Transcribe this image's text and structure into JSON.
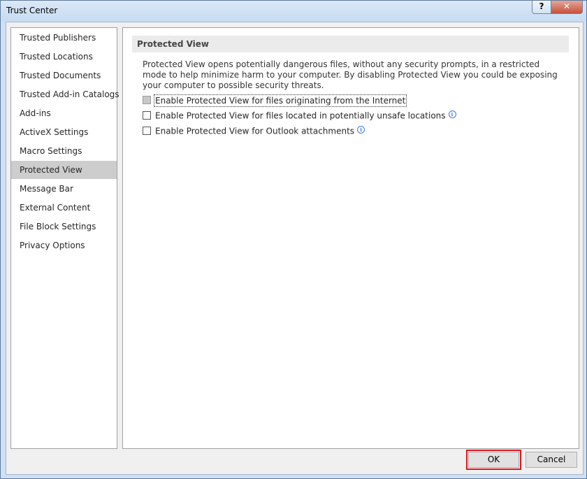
{
  "window": {
    "title": "Trust Center",
    "help_label": "?",
    "close_label": "✕"
  },
  "sidebar": {
    "items": [
      {
        "label": "Trusted Publishers"
      },
      {
        "label": "Trusted Locations"
      },
      {
        "label": "Trusted Documents"
      },
      {
        "label": "Trusted Add-in Catalogs"
      },
      {
        "label": "Add-ins"
      },
      {
        "label": "ActiveX Settings"
      },
      {
        "label": "Macro Settings"
      },
      {
        "label": "Protected View",
        "selected": true
      },
      {
        "label": "Message Bar"
      },
      {
        "label": "External Content"
      },
      {
        "label": "File Block Settings"
      },
      {
        "label": "Privacy Options"
      }
    ]
  },
  "main": {
    "section_title": "Protected View",
    "description": "Protected View opens potentially dangerous files, without any security prompts, in a restricted mode to help minimize harm to your computer. By disabling Protected View you could be exposing your computer to possible security threats.",
    "options": [
      {
        "label": "Enable Protected View for files originating from the Internet",
        "checked": false,
        "state": "disabled-focused"
      },
      {
        "label": "Enable Protected View for files located in potentially unsafe locations",
        "checked": false,
        "info_icon": "info-icon"
      },
      {
        "label": "Enable Protected View for Outlook attachments",
        "checked": false,
        "info_icon": "info-icon"
      }
    ],
    "info_glyph": "i"
  },
  "footer": {
    "ok_label": "OK",
    "cancel_label": "Cancel",
    "highlight_color": "#e0161d"
  }
}
